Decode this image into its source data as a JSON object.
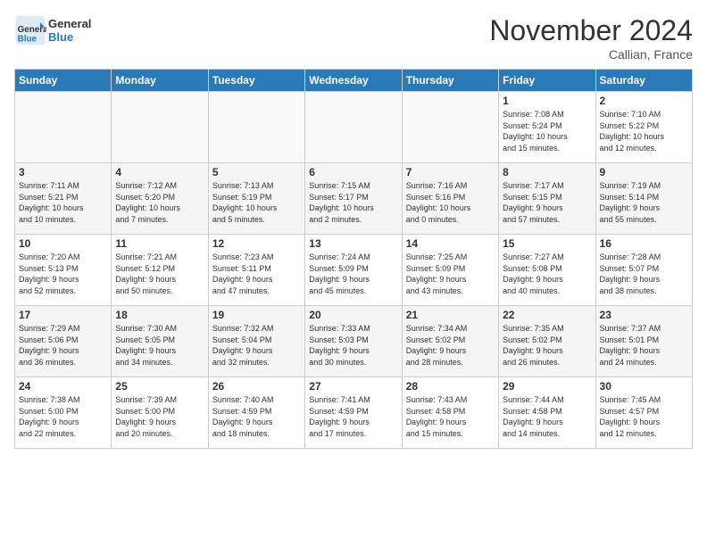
{
  "header": {
    "logo_line1": "General",
    "logo_line2": "Blue",
    "month": "November 2024",
    "location": "Callian, France"
  },
  "weekdays": [
    "Sunday",
    "Monday",
    "Tuesday",
    "Wednesday",
    "Thursday",
    "Friday",
    "Saturday"
  ],
  "weeks": [
    [
      {
        "day": "",
        "info": ""
      },
      {
        "day": "",
        "info": ""
      },
      {
        "day": "",
        "info": ""
      },
      {
        "day": "",
        "info": ""
      },
      {
        "day": "",
        "info": ""
      },
      {
        "day": "1",
        "info": "Sunrise: 7:08 AM\nSunset: 5:24 PM\nDaylight: 10 hours\nand 15 minutes."
      },
      {
        "day": "2",
        "info": "Sunrise: 7:10 AM\nSunset: 5:22 PM\nDaylight: 10 hours\nand 12 minutes."
      }
    ],
    [
      {
        "day": "3",
        "info": "Sunrise: 7:11 AM\nSunset: 5:21 PM\nDaylight: 10 hours\nand 10 minutes."
      },
      {
        "day": "4",
        "info": "Sunrise: 7:12 AM\nSunset: 5:20 PM\nDaylight: 10 hours\nand 7 minutes."
      },
      {
        "day": "5",
        "info": "Sunrise: 7:13 AM\nSunset: 5:19 PM\nDaylight: 10 hours\nand 5 minutes."
      },
      {
        "day": "6",
        "info": "Sunrise: 7:15 AM\nSunset: 5:17 PM\nDaylight: 10 hours\nand 2 minutes."
      },
      {
        "day": "7",
        "info": "Sunrise: 7:16 AM\nSunset: 5:16 PM\nDaylight: 10 hours\nand 0 minutes."
      },
      {
        "day": "8",
        "info": "Sunrise: 7:17 AM\nSunset: 5:15 PM\nDaylight: 9 hours\nand 57 minutes."
      },
      {
        "day": "9",
        "info": "Sunrise: 7:19 AM\nSunset: 5:14 PM\nDaylight: 9 hours\nand 55 minutes."
      }
    ],
    [
      {
        "day": "10",
        "info": "Sunrise: 7:20 AM\nSunset: 5:13 PM\nDaylight: 9 hours\nand 52 minutes."
      },
      {
        "day": "11",
        "info": "Sunrise: 7:21 AM\nSunset: 5:12 PM\nDaylight: 9 hours\nand 50 minutes."
      },
      {
        "day": "12",
        "info": "Sunrise: 7:23 AM\nSunset: 5:11 PM\nDaylight: 9 hours\nand 47 minutes."
      },
      {
        "day": "13",
        "info": "Sunrise: 7:24 AM\nSunset: 5:09 PM\nDaylight: 9 hours\nand 45 minutes."
      },
      {
        "day": "14",
        "info": "Sunrise: 7:25 AM\nSunset: 5:09 PM\nDaylight: 9 hours\nand 43 minutes."
      },
      {
        "day": "15",
        "info": "Sunrise: 7:27 AM\nSunset: 5:08 PM\nDaylight: 9 hours\nand 40 minutes."
      },
      {
        "day": "16",
        "info": "Sunrise: 7:28 AM\nSunset: 5:07 PM\nDaylight: 9 hours\nand 38 minutes."
      }
    ],
    [
      {
        "day": "17",
        "info": "Sunrise: 7:29 AM\nSunset: 5:06 PM\nDaylight: 9 hours\nand 36 minutes."
      },
      {
        "day": "18",
        "info": "Sunrise: 7:30 AM\nSunset: 5:05 PM\nDaylight: 9 hours\nand 34 minutes."
      },
      {
        "day": "19",
        "info": "Sunrise: 7:32 AM\nSunset: 5:04 PM\nDaylight: 9 hours\nand 32 minutes."
      },
      {
        "day": "20",
        "info": "Sunrise: 7:33 AM\nSunset: 5:03 PM\nDaylight: 9 hours\nand 30 minutes."
      },
      {
        "day": "21",
        "info": "Sunrise: 7:34 AM\nSunset: 5:02 PM\nDaylight: 9 hours\nand 28 minutes."
      },
      {
        "day": "22",
        "info": "Sunrise: 7:35 AM\nSunset: 5:02 PM\nDaylight: 9 hours\nand 26 minutes."
      },
      {
        "day": "23",
        "info": "Sunrise: 7:37 AM\nSunset: 5:01 PM\nDaylight: 9 hours\nand 24 minutes."
      }
    ],
    [
      {
        "day": "24",
        "info": "Sunrise: 7:38 AM\nSunset: 5:00 PM\nDaylight: 9 hours\nand 22 minutes."
      },
      {
        "day": "25",
        "info": "Sunrise: 7:39 AM\nSunset: 5:00 PM\nDaylight: 9 hours\nand 20 minutes."
      },
      {
        "day": "26",
        "info": "Sunrise: 7:40 AM\nSunset: 4:59 PM\nDaylight: 9 hours\nand 18 minutes."
      },
      {
        "day": "27",
        "info": "Sunrise: 7:41 AM\nSunset: 4:59 PM\nDaylight: 9 hours\nand 17 minutes."
      },
      {
        "day": "28",
        "info": "Sunrise: 7:43 AM\nSunset: 4:58 PM\nDaylight: 9 hours\nand 15 minutes."
      },
      {
        "day": "29",
        "info": "Sunrise: 7:44 AM\nSunset: 4:58 PM\nDaylight: 9 hours\nand 14 minutes."
      },
      {
        "day": "30",
        "info": "Sunrise: 7:45 AM\nSunset: 4:57 PM\nDaylight: 9 hours\nand 12 minutes."
      }
    ]
  ]
}
